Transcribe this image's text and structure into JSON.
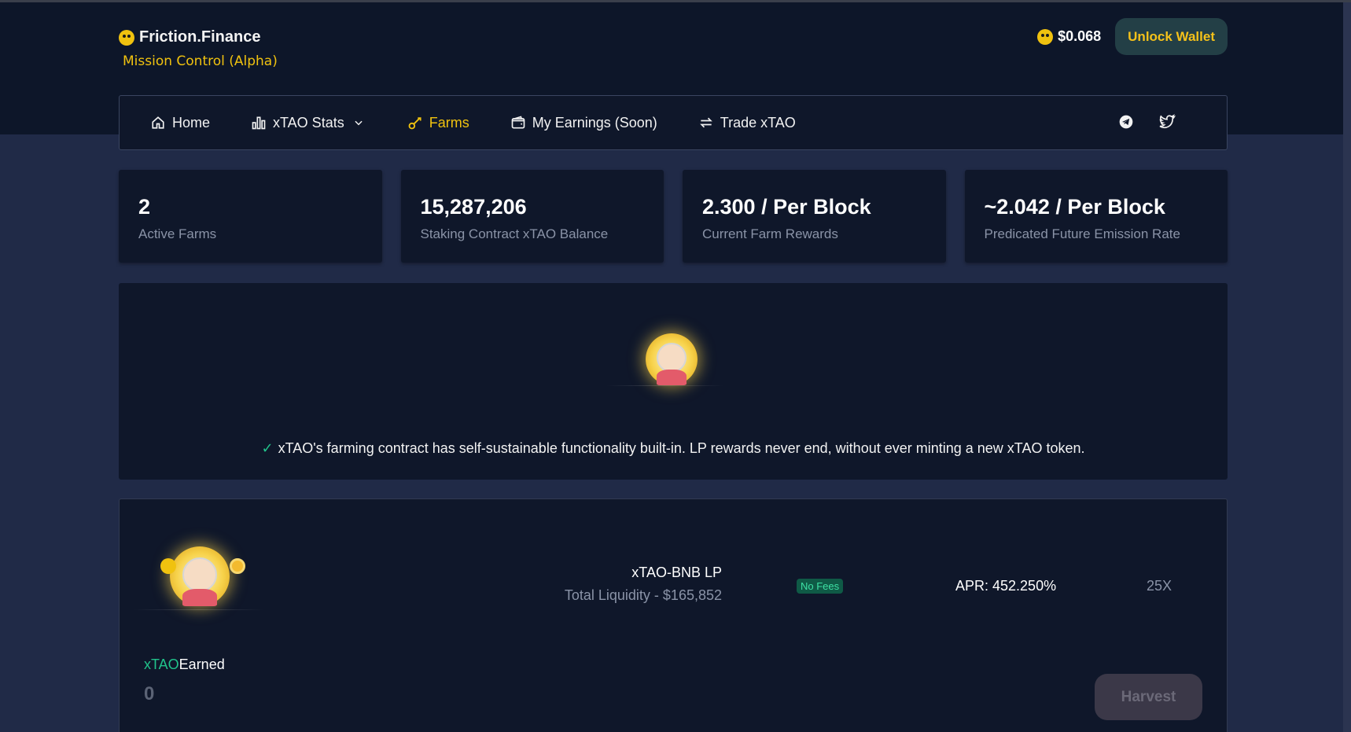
{
  "header": {
    "brand_name": "Friction.Finance",
    "brand_subtitle": "Mission Control (Alpha)",
    "token_price": "$0.068",
    "unlock_button": "Unlock Wallet"
  },
  "nav": {
    "items": [
      {
        "label": "Home",
        "icon": "home-icon",
        "active": false
      },
      {
        "label": "xTAO Stats",
        "icon": "bar-chart-icon",
        "active": false,
        "dropdown": true
      },
      {
        "label": "Farms",
        "icon": "farm-tool-icon",
        "active": true
      },
      {
        "label": "My Earnings (Soon)",
        "icon": "wallet-icon",
        "active": false
      },
      {
        "label": "Trade xTAO",
        "icon": "swap-icon",
        "active": false
      }
    ],
    "social": [
      "telegram-icon",
      "twitter-icon"
    ]
  },
  "stats": [
    {
      "value": "2",
      "label": "Active Farms"
    },
    {
      "value": "15,287,206",
      "label": "Staking Contract xTAO Balance"
    },
    {
      "value": "2.300 / Per Block",
      "label": "Current Farm Rewards"
    },
    {
      "value": "~2.042 / Per Block",
      "label": "Predicated Future Emission Rate"
    }
  ],
  "info": {
    "text": "xTAO's farming contract has self-sustainable functionality built-in. LP rewards never end, without ever minting a new xTAO token."
  },
  "farm": {
    "pair_name": "xTAO-BNB LP",
    "liquidity": "Total Liquidity - $165,852",
    "fees_badge": "No Fees",
    "apr": "APR: 452.250%",
    "multiplier": "25X",
    "earned_token": "xTAO",
    "earned_suffix": "Earned",
    "earned_value": "0",
    "harvest_button": "Harvest"
  },
  "colors": {
    "accent_yellow": "#f0c20f",
    "accent_green": "#21c38b",
    "card_bg": "#0f172a",
    "page_bg": "#202a47"
  }
}
